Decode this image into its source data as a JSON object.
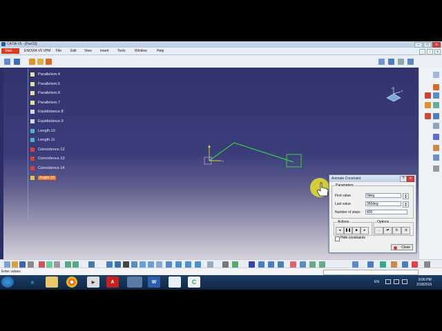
{
  "window": {
    "title": "CATIA V5 - [Part10]"
  },
  "menu": {
    "start": "Start",
    "items": [
      "ENOVIA V5 VPM",
      "File",
      "Edit",
      "View",
      "Insert",
      "Tools",
      "Window",
      "Help"
    ]
  },
  "spec_tree": {
    "items": [
      {
        "label": "Parallelism.4",
        "icon": "parallelism-icon"
      },
      {
        "label": "Parallelism.5",
        "icon": "parallelism-icon"
      },
      {
        "label": "Parallelism.6",
        "icon": "parallelism-icon"
      },
      {
        "label": "Parallelism.7",
        "icon": "parallelism-icon"
      },
      {
        "label": "Equidistance.8",
        "icon": "equidistance-icon"
      },
      {
        "label": "Equidistance.9",
        "icon": "equidistance-icon"
      },
      {
        "label": "Length.10",
        "icon": "length-icon"
      },
      {
        "label": "Length.11",
        "icon": "length-icon"
      },
      {
        "label": "Coincidence.12",
        "icon": "coincidence-icon"
      },
      {
        "label": "Coincidence.13",
        "icon": "coincidence-icon"
      },
      {
        "label": "Coincidence.14",
        "icon": "coincidence-icon"
      },
      {
        "label": "Angle.15",
        "icon": "angle-icon",
        "selected": true
      }
    ]
  },
  "dialog": {
    "title": "Animate Constraint",
    "parameters_group": "Parameters",
    "first_value_label": "First value",
    "first_value": "0deg",
    "last_value_label": "Last value",
    "last_value": "360deg",
    "steps_label": "Number of steps",
    "steps_value": "400",
    "actions_group": "Actions",
    "options_group": "Options",
    "hide_constraints_label": "Hide constraints",
    "hide_constraints_checked": false,
    "close_label": "Close"
  },
  "status": {
    "text": "Enter values"
  },
  "tray": {
    "language": "EN",
    "time": "8:06 PM",
    "date": "2/18/2015"
  },
  "colors": {
    "accent": "#f07a1d",
    "sketch": "#39d03a",
    "viewport_top": "#31346e"
  }
}
